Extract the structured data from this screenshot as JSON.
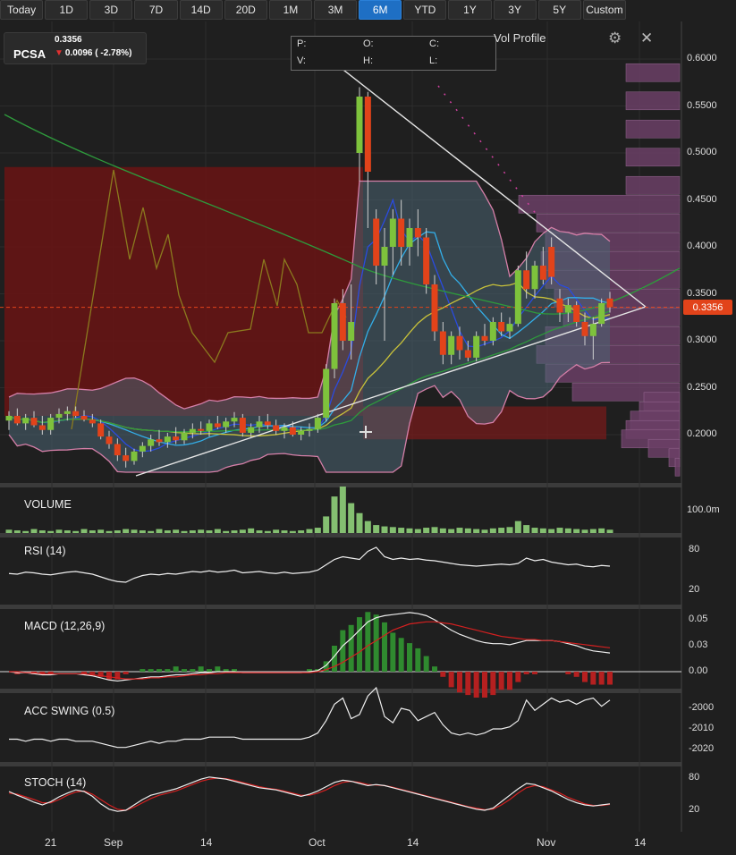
{
  "toolbar": {
    "ranges": [
      "Today",
      "1D",
      "3D",
      "7D",
      "14D",
      "20D",
      "1M",
      "3M",
      "6M",
      "YTD",
      "1Y",
      "3Y",
      "5Y",
      "Custom"
    ],
    "active": "6M"
  },
  "quote": {
    "ticker": "PCSA",
    "last": "0.3356",
    "change": "0.0096 ( -2.78%)",
    "direction": "down"
  },
  "ohlc_box": {
    "p": "P:",
    "o": "O:",
    "c": "C:",
    "v": "V:",
    "h": "H:",
    "l": "L:"
  },
  "overlays": {
    "vol_profile_label": "Vol Profile"
  },
  "price_tag": "0.3356",
  "colors": {
    "up": "#7ec23c",
    "down": "#e2431a",
    "accent": "#1e6fc4",
    "bollinger_fill": "#4a6472",
    "profile": "#6b3f66"
  },
  "panels": {
    "volume": {
      "label": "VOLUME",
      "axis": [
        "100.0m"
      ]
    },
    "rsi": {
      "label": "RSI (14)",
      "axis": [
        "80",
        "20"
      ]
    },
    "macd": {
      "label": "MACD (12,26,9)",
      "axis": [
        "0.05",
        "0.03",
        "0.00"
      ]
    },
    "acc": {
      "label": "ACC SWING (0.5)",
      "axis": [
        "-2000",
        "-2010",
        "-2020"
      ]
    },
    "stoch": {
      "label": "STOCH (14)",
      "axis": [
        "80",
        "20"
      ]
    }
  },
  "price_axis": [
    "0.6000",
    "0.5500",
    "0.5000",
    "0.4500",
    "0.4000",
    "0.3500",
    "0.3000",
    "0.2500",
    "0.2000"
  ],
  "x_axis": [
    "21",
    "Sep",
    "14",
    "Oct",
    "14",
    "Nov",
    "14"
  ],
  "chart_data": {
    "type": "candlestick",
    "symbol": "PCSA",
    "range": "6M",
    "ylim": [
      0.155,
      0.625
    ],
    "candles": [
      {
        "o": 0.215,
        "h": 0.225,
        "l": 0.205,
        "c": 0.22
      },
      {
        "o": 0.22,
        "h": 0.228,
        "l": 0.21,
        "c": 0.212
      },
      {
        "o": 0.212,
        "h": 0.222,
        "l": 0.205,
        "c": 0.218
      },
      {
        "o": 0.218,
        "h": 0.225,
        "l": 0.208,
        "c": 0.21
      },
      {
        "o": 0.21,
        "h": 0.22,
        "l": 0.2,
        "c": 0.205
      },
      {
        "o": 0.205,
        "h": 0.222,
        "l": 0.2,
        "c": 0.218
      },
      {
        "o": 0.218,
        "h": 0.228,
        "l": 0.212,
        "c": 0.222
      },
      {
        "o": 0.222,
        "h": 0.23,
        "l": 0.215,
        "c": 0.225
      },
      {
        "o": 0.225,
        "h": 0.23,
        "l": 0.218,
        "c": 0.22
      },
      {
        "o": 0.22,
        "h": 0.226,
        "l": 0.214,
        "c": 0.216
      },
      {
        "o": 0.216,
        "h": 0.222,
        "l": 0.208,
        "c": 0.212
      },
      {
        "o": 0.212,
        "h": 0.216,
        "l": 0.195,
        "c": 0.198
      },
      {
        "o": 0.198,
        "h": 0.204,
        "l": 0.185,
        "c": 0.19
      },
      {
        "o": 0.19,
        "h": 0.196,
        "l": 0.172,
        "c": 0.178
      },
      {
        "o": 0.178,
        "h": 0.186,
        "l": 0.165,
        "c": 0.172
      },
      {
        "o": 0.172,
        "h": 0.185,
        "l": 0.168,
        "c": 0.182
      },
      {
        "o": 0.182,
        "h": 0.192,
        "l": 0.176,
        "c": 0.188
      },
      {
        "o": 0.188,
        "h": 0.2,
        "l": 0.182,
        "c": 0.195
      },
      {
        "o": 0.195,
        "h": 0.205,
        "l": 0.188,
        "c": 0.192
      },
      {
        "o": 0.192,
        "h": 0.202,
        "l": 0.186,
        "c": 0.198
      },
      {
        "o": 0.198,
        "h": 0.208,
        "l": 0.19,
        "c": 0.194
      },
      {
        "o": 0.194,
        "h": 0.206,
        "l": 0.19,
        "c": 0.202
      },
      {
        "o": 0.202,
        "h": 0.212,
        "l": 0.196,
        "c": 0.206
      },
      {
        "o": 0.206,
        "h": 0.214,
        "l": 0.2,
        "c": 0.204
      },
      {
        "o": 0.204,
        "h": 0.216,
        "l": 0.198,
        "c": 0.212
      },
      {
        "o": 0.212,
        "h": 0.22,
        "l": 0.206,
        "c": 0.208
      },
      {
        "o": 0.208,
        "h": 0.218,
        "l": 0.202,
        "c": 0.214
      },
      {
        "o": 0.214,
        "h": 0.224,
        "l": 0.208,
        "c": 0.218
      },
      {
        "o": 0.218,
        "h": 0.222,
        "l": 0.198,
        "c": 0.202
      },
      {
        "o": 0.202,
        "h": 0.212,
        "l": 0.196,
        "c": 0.208
      },
      {
        "o": 0.208,
        "h": 0.22,
        "l": 0.202,
        "c": 0.214
      },
      {
        "o": 0.214,
        "h": 0.222,
        "l": 0.206,
        "c": 0.21
      },
      {
        "o": 0.21,
        "h": 0.216,
        "l": 0.2,
        "c": 0.204
      },
      {
        "o": 0.204,
        "h": 0.212,
        "l": 0.196,
        "c": 0.208
      },
      {
        "o": 0.208,
        "h": 0.214,
        "l": 0.198,
        "c": 0.2
      },
      {
        "o": 0.2,
        "h": 0.208,
        "l": 0.194,
        "c": 0.204
      },
      {
        "o": 0.204,
        "h": 0.212,
        "l": 0.198,
        "c": 0.206
      },
      {
        "o": 0.206,
        "h": 0.222,
        "l": 0.202,
        "c": 0.218
      },
      {
        "o": 0.218,
        "h": 0.275,
        "l": 0.214,
        "c": 0.27
      },
      {
        "o": 0.27,
        "h": 0.345,
        "l": 0.26,
        "c": 0.34
      },
      {
        "o": 0.34,
        "h": 0.355,
        "l": 0.29,
        "c": 0.3
      },
      {
        "o": 0.3,
        "h": 0.36,
        "l": 0.28,
        "c": 0.32
      },
      {
        "o": 0.5,
        "h": 0.57,
        "l": 0.47,
        "c": 0.56
      },
      {
        "o": 0.56,
        "h": 0.565,
        "l": 0.42,
        "c": 0.48
      },
      {
        "o": 0.43,
        "h": 0.44,
        "l": 0.36,
        "c": 0.38
      },
      {
        "o": 0.38,
        "h": 0.42,
        "l": 0.3,
        "c": 0.4
      },
      {
        "o": 0.4,
        "h": 0.44,
        "l": 0.37,
        "c": 0.43
      },
      {
        "o": 0.43,
        "h": 0.45,
        "l": 0.38,
        "c": 0.4
      },
      {
        "o": 0.4,
        "h": 0.43,
        "l": 0.38,
        "c": 0.42
      },
      {
        "o": 0.42,
        "h": 0.44,
        "l": 0.39,
        "c": 0.41
      },
      {
        "o": 0.41,
        "h": 0.42,
        "l": 0.35,
        "c": 0.36
      },
      {
        "o": 0.36,
        "h": 0.37,
        "l": 0.3,
        "c": 0.31
      },
      {
        "o": 0.31,
        "h": 0.32,
        "l": 0.275,
        "c": 0.285
      },
      {
        "o": 0.285,
        "h": 0.31,
        "l": 0.275,
        "c": 0.305
      },
      {
        "o": 0.305,
        "h": 0.315,
        "l": 0.28,
        "c": 0.29
      },
      {
        "o": 0.29,
        "h": 0.3,
        "l": 0.278,
        "c": 0.282
      },
      {
        "o": 0.282,
        "h": 0.31,
        "l": 0.278,
        "c": 0.305
      },
      {
        "o": 0.305,
        "h": 0.318,
        "l": 0.295,
        "c": 0.3
      },
      {
        "o": 0.3,
        "h": 0.325,
        "l": 0.295,
        "c": 0.32
      },
      {
        "o": 0.32,
        "h": 0.33,
        "l": 0.305,
        "c": 0.31
      },
      {
        "o": 0.31,
        "h": 0.325,
        "l": 0.302,
        "c": 0.318
      },
      {
        "o": 0.318,
        "h": 0.38,
        "l": 0.315,
        "c": 0.375
      },
      {
        "o": 0.375,
        "h": 0.395,
        "l": 0.345,
        "c": 0.355
      },
      {
        "o": 0.355,
        "h": 0.385,
        "l": 0.345,
        "c": 0.38
      },
      {
        "o": 0.38,
        "h": 0.4,
        "l": 0.36,
        "c": 0.365
      },
      {
        "o": 0.4,
        "h": 0.41,
        "l": 0.36,
        "c": 0.368
      },
      {
        "o": 0.345,
        "h": 0.355,
        "l": 0.32,
        "c": 0.33
      },
      {
        "o": 0.33,
        "h": 0.345,
        "l": 0.32,
        "c": 0.338
      },
      {
        "o": 0.338,
        "h": 0.342,
        "l": 0.315,
        "c": 0.32
      },
      {
        "o": 0.32,
        "h": 0.33,
        "l": 0.295,
        "c": 0.305
      },
      {
        "o": 0.305,
        "h": 0.325,
        "l": 0.28,
        "c": 0.318
      },
      {
        "o": 0.318,
        "h": 0.345,
        "l": 0.315,
        "c": 0.34
      },
      {
        "o": 0.345,
        "h": 0.352,
        "l": 0.33,
        "c": 0.3356
      }
    ],
    "volume": [
      5,
      4,
      3,
      6,
      4,
      3,
      5,
      4,
      3,
      6,
      4,
      5,
      3,
      4,
      6,
      5,
      4,
      3,
      6,
      4,
      5,
      3,
      4,
      5,
      4,
      6,
      3,
      4,
      5,
      7,
      4,
      3,
      5,
      4,
      3,
      4,
      6,
      8,
      25,
      55,
      70,
      45,
      30,
      18,
      12,
      10,
      9,
      8,
      7,
      6,
      8,
      9,
      7,
      6,
      8,
      7,
      6,
      5,
      7,
      8,
      9,
      18,
      12,
      8,
      7,
      6,
      8,
      7,
      6,
      5,
      6,
      7,
      5
    ],
    "rsi": [
      45,
      44,
      47,
      46,
      44,
      43,
      45,
      47,
      48,
      46,
      44,
      40,
      36,
      33,
      32,
      38,
      42,
      44,
      43,
      45,
      44,
      46,
      48,
      47,
      49,
      47,
      48,
      50,
      46,
      47,
      48,
      46,
      45,
      47,
      45,
      46,
      47,
      50,
      58,
      66,
      70,
      68,
      66,
      78,
      84,
      70,
      66,
      68,
      66,
      67,
      65,
      64,
      62,
      60,
      58,
      57,
      56,
      57,
      58,
      59,
      58,
      60,
      68,
      64,
      66,
      62,
      60,
      58,
      59,
      56,
      55,
      57,
      56
    ],
    "macd": [
      0.0,
      -0.001,
      -0.001,
      -0.002,
      -0.003,
      -0.003,
      -0.002,
      -0.002,
      -0.002,
      -0.003,
      -0.004,
      -0.006,
      -0.008,
      -0.009,
      -0.008,
      -0.007,
      -0.006,
      -0.005,
      -0.005,
      -0.004,
      -0.003,
      -0.003,
      -0.002,
      -0.001,
      -0.001,
      0.0,
      0.0,
      0.0,
      -0.001,
      -0.001,
      -0.001,
      -0.001,
      -0.001,
      -0.001,
      -0.001,
      -0.001,
      0.0,
      0.001,
      0.006,
      0.015,
      0.025,
      0.032,
      0.04,
      0.048,
      0.052,
      0.054,
      0.055,
      0.056,
      0.057,
      0.056,
      0.054,
      0.05,
      0.045,
      0.04,
      0.036,
      0.033,
      0.03,
      0.028,
      0.027,
      0.027,
      0.026,
      0.028,
      0.03,
      0.03,
      0.03,
      0.03,
      0.029,
      0.027,
      0.025,
      0.022,
      0.02,
      0.019,
      0.018
    ],
    "macd_signal": [
      0.0,
      0.0,
      -0.001,
      -0.001,
      -0.002,
      -0.002,
      -0.002,
      -0.002,
      -0.002,
      -0.002,
      -0.003,
      -0.004,
      -0.005,
      -0.006,
      -0.007,
      -0.007,
      -0.007,
      -0.006,
      -0.006,
      -0.005,
      -0.005,
      -0.004,
      -0.003,
      -0.003,
      -0.002,
      -0.002,
      -0.001,
      -0.001,
      -0.001,
      -0.001,
      -0.001,
      -0.001,
      -0.001,
      -0.001,
      -0.001,
      -0.001,
      -0.001,
      0.0,
      0.002,
      0.005,
      0.009,
      0.014,
      0.019,
      0.025,
      0.03,
      0.035,
      0.04,
      0.043,
      0.046,
      0.047,
      0.048,
      0.048,
      0.047,
      0.046,
      0.044,
      0.042,
      0.04,
      0.038,
      0.036,
      0.034,
      0.033,
      0.032,
      0.031,
      0.031,
      0.03,
      0.03,
      0.029,
      0.028,
      0.027,
      0.026,
      0.025,
      0.024,
      0.023
    ],
    "acc_swing": [
      -2015,
      -2015,
      -2016,
      -2015,
      -2015,
      -2016,
      -2015,
      -2015,
      -2016,
      -2016,
      -2016,
      -2017,
      -2018,
      -2019,
      -2019,
      -2018,
      -2017,
      -2016,
      -2017,
      -2016,
      -2016,
      -2015,
      -2015,
      -2015,
      -2014,
      -2014,
      -2014,
      -2014,
      -2015,
      -2015,
      -2015,
      -2015,
      -2015,
      -2015,
      -2015,
      -2015,
      -2014,
      -2012,
      -2006,
      -1998,
      -1995,
      -2005,
      -2003,
      -1994,
      -1990,
      -2004,
      -2007,
      -2000,
      -2001,
      -2006,
      -2004,
      -2002,
      -2008,
      -2012,
      -2013,
      -2012,
      -2013,
      -2012,
      -2010,
      -2010,
      -2009,
      -2006,
      -1996,
      -2001,
      -1998,
      -1995,
      -1997,
      -1996,
      -1998,
      -1996,
      -1995,
      -1999,
      -1996
    ],
    "stoch": [
      55,
      48,
      42,
      35,
      30,
      36,
      45,
      52,
      58,
      55,
      46,
      32,
      22,
      18,
      20,
      30,
      40,
      48,
      52,
      56,
      60,
      66,
      72,
      78,
      82,
      80,
      78,
      74,
      70,
      66,
      62,
      60,
      58,
      54,
      50,
      46,
      50,
      56,
      64,
      72,
      76,
      74,
      70,
      66,
      68,
      66,
      62,
      58,
      54,
      50,
      46,
      42,
      38,
      34,
      30,
      26,
      22,
      20,
      24,
      36,
      48,
      60,
      70,
      68,
      62,
      56,
      48,
      40,
      34,
      30,
      28,
      30,
      32
    ],
    "stoch_signal": [
      52,
      50,
      45,
      40,
      34,
      34,
      40,
      48,
      54,
      56,
      50,
      40,
      30,
      22,
      20,
      26,
      34,
      42,
      48,
      52,
      56,
      62,
      68,
      74,
      78,
      80,
      79,
      76,
      72,
      68,
      64,
      61,
      59,
      56,
      52,
      48,
      48,
      52,
      58,
      66,
      72,
      74,
      72,
      68,
      67,
      66,
      63,
      59,
      55,
      51,
      47,
      43,
      39,
      35,
      31,
      27,
      24,
      21,
      22,
      30,
      40,
      52,
      62,
      66,
      64,
      58,
      52,
      44,
      38,
      32,
      29,
      29,
      31
    ]
  }
}
